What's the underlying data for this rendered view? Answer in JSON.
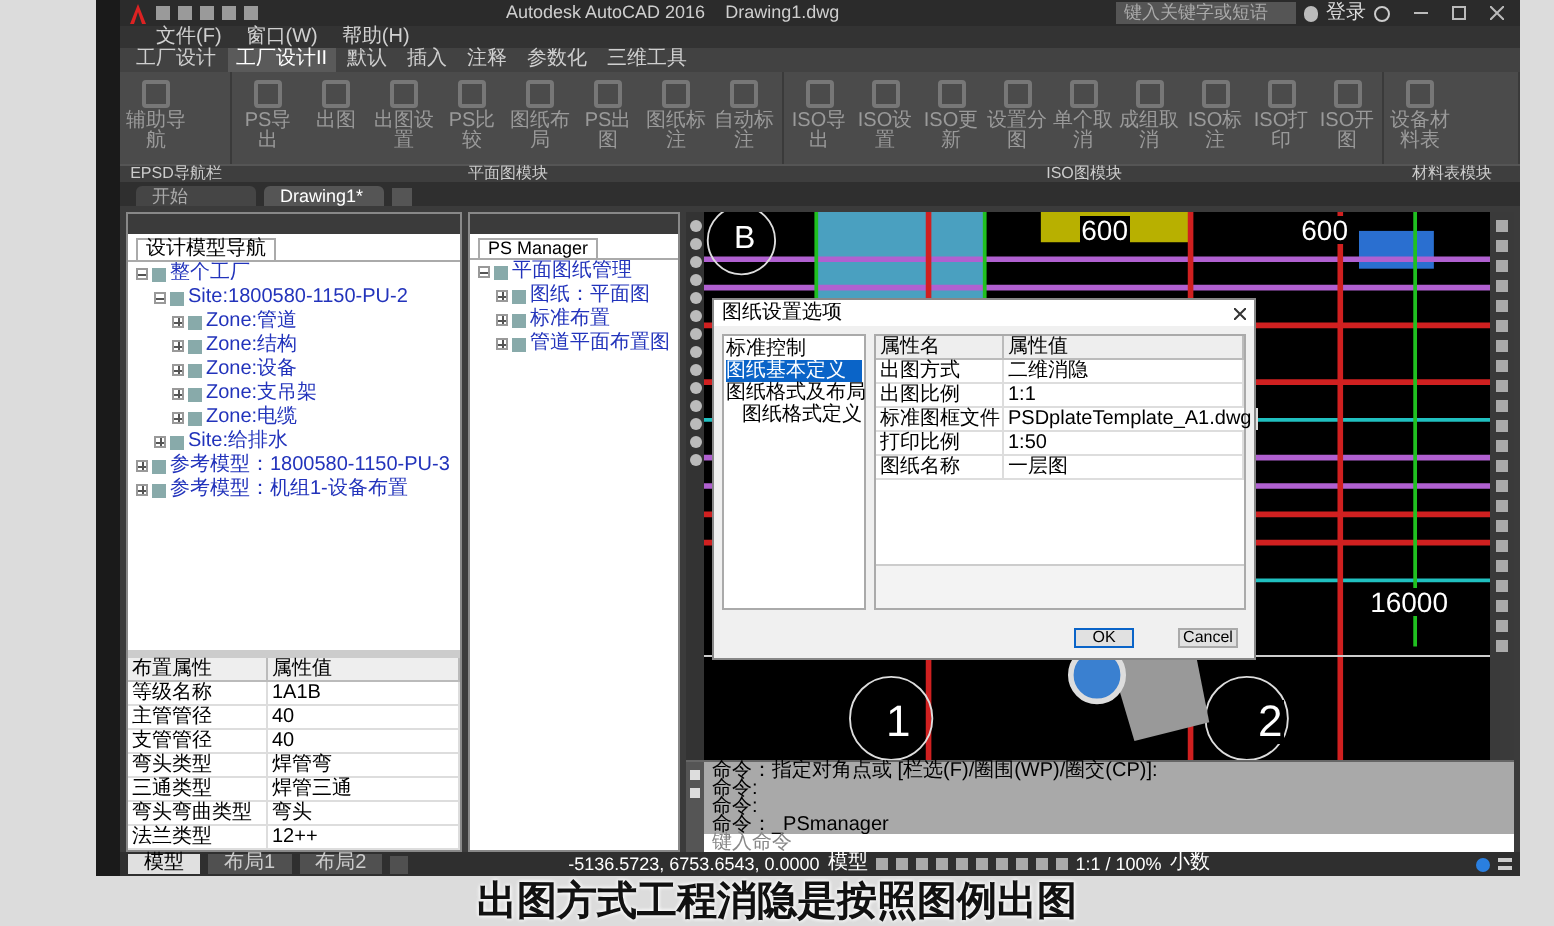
{
  "window": {
    "title": "Autodesk AutoCAD 2016    Drawing1.dwg",
    "search": {
      "placeholder": "键入关键字或短语"
    },
    "login": "登录"
  },
  "menu": [
    "文件(F)",
    "窗口(W)",
    "帮助(H)"
  ],
  "ribbon_tabs": [
    {
      "label": "工厂设计",
      "selected": false
    },
    {
      "label": "工厂设计II",
      "selected": true
    },
    {
      "label": "默认",
      "selected": false
    },
    {
      "label": "插入",
      "selected": false
    },
    {
      "label": "注释",
      "selected": false
    },
    {
      "label": "参数化",
      "selected": false
    },
    {
      "label": "三维工具",
      "selected": false
    }
  ],
  "ribbon_panels": [
    {
      "label": "EPSD导航栏",
      "buttons": [
        "辅助导航"
      ]
    },
    {
      "label": "平面图模块",
      "buttons": [
        "PS导出",
        "出图",
        "出图设置",
        "PS比较",
        "图纸布局",
        "PS出图",
        "图纸标注",
        "自动标注"
      ]
    },
    {
      "label": "ISO图模块",
      "buttons": [
        "ISO导出",
        "ISO设置",
        "ISO更新",
        "设置分图",
        "单个取消",
        "成组取消",
        "ISO标注",
        "ISO打印",
        "ISO开图"
      ]
    },
    {
      "label": "材料表模块",
      "buttons": [
        "设备材料表"
      ]
    }
  ],
  "doc_tabs": [
    {
      "label": "开始",
      "selected": false
    },
    {
      "label": "Drawing1*",
      "selected": true
    }
  ],
  "model_navigator": {
    "tab": "设计模型导航",
    "tree": [
      {
        "label": "整个工厂",
        "expanded": true,
        "children": [
          {
            "label": "Site:1800580-1150-PU-2",
            "expanded": true,
            "children": [
              {
                "label": "Zone:管道",
                "expanded": false
              },
              {
                "label": "Zone:结构",
                "expanded": false
              },
              {
                "label": "Zone:设备",
                "expanded": false
              },
              {
                "label": "Zone:支吊架",
                "expanded": false
              },
              {
                "label": "Zone:电缆",
                "expanded": false
              }
            ]
          },
          {
            "label": "Site:给排水",
            "expanded": false
          }
        ]
      },
      {
        "label": "参考模型：1800580-1150-PU-3",
        "expanded": false
      },
      {
        "label": "参考模型：机组1-设备布置",
        "expanded": false
      }
    ]
  },
  "properties": {
    "columns": [
      "布置属性",
      "属性值"
    ],
    "rows": [
      [
        "等级名称",
        "1A1B"
      ],
      [
        "主管管径",
        "40"
      ],
      [
        "支管管径",
        "40"
      ],
      [
        "弯头类型",
        "焊管弯"
      ],
      [
        "三通类型",
        "焊管三通"
      ],
      [
        "弯头弯曲类型",
        "弯头"
      ],
      [
        "法兰类型",
        "12++"
      ]
    ]
  },
  "ps_manager": {
    "tab": "PS Manager",
    "tree": [
      {
        "label": "平面图纸管理",
        "expanded": true,
        "children": [
          {
            "label": "图纸：平面图",
            "expanded": false
          },
          {
            "label": "标准布置",
            "expanded": false
          },
          {
            "label": "管道平面布置图",
            "expanded": false
          }
        ]
      }
    ]
  },
  "drawing": {
    "labels": [
      "600",
      "600",
      "1",
      "2",
      "16000",
      "B"
    ]
  },
  "dialog": {
    "title": "图纸设置选项",
    "nav": [
      {
        "label": "标准控制",
        "selected": false
      },
      {
        "label": "图纸基本定义",
        "selected": true
      },
      {
        "label": "图纸格式及布局",
        "selected": false,
        "children": [
          {
            "label": "图纸格式定义",
            "selected": false
          }
        ]
      }
    ],
    "columns": [
      "属性名",
      "属性值"
    ],
    "rows": [
      [
        "出图方式",
        "二维消隐"
      ],
      [
        "出图比例",
        "1:1"
      ],
      [
        "标准图框文件",
        "PSDplateTemplate_A1.dwg"
      ],
      [
        "打印比例",
        "1:50"
      ],
      [
        "图纸名称",
        "一层图"
      ]
    ],
    "buttons": [
      "OK",
      "Cancel"
    ]
  },
  "command": {
    "history": [
      "命令：指定对角点或 [栏选(F)/圈围(WP)/圈交(CP)]:",
      "命令:",
      "命令:",
      "命令：_PSmanager"
    ],
    "placeholder": "键入命令"
  },
  "layout_tabs": [
    {
      "label": "模型",
      "selected": true
    },
    {
      "label": "布局1",
      "selected": false
    },
    {
      "label": "布局2",
      "selected": false
    }
  ],
  "status_bar": {
    "coordinates": "-5136.5723, 6753.6543, 0.0000",
    "space": "模型",
    "scale": "1:1 / 100%",
    "units": "小数"
  },
  "subtitle": "出图方式工程消隐是按照图例出图"
}
